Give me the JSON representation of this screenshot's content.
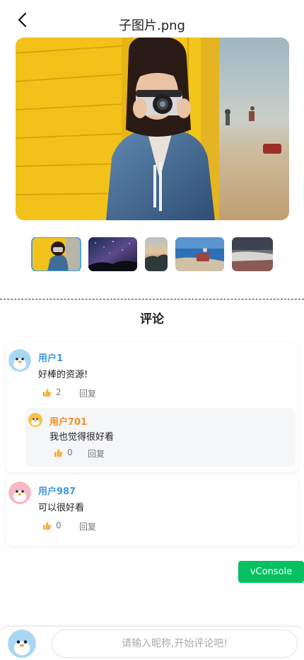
{
  "header": {
    "title": "子图片.png"
  },
  "section_title": "评论",
  "comments": [
    {
      "user": "用户1",
      "user_color": "#3f9ae6",
      "avatar_color": "#a9d7f3",
      "text": "好棒的资源!",
      "likes": "2",
      "reply_label": "回复",
      "replies": [
        {
          "user": "用户701",
          "user_color": "#f0902a",
          "avatar_color": "#f6c342",
          "text": "我也觉得很好看",
          "likes": "0",
          "reply_label": "回复"
        }
      ]
    },
    {
      "user": "用户987",
      "user_color": "#3f9ae6",
      "avatar_color": "#f6b8c4",
      "text": "可以很好看",
      "likes": "0",
      "reply_label": "回复"
    }
  ],
  "vconsole": {
    "label": "vConsole",
    "color": "#07c160"
  },
  "comment_input": {
    "placeholder": "请输入昵称,开始评论吧!"
  },
  "icons": [
    "back-arrow-icon",
    "thumbs-up-icon",
    "avatar-icon"
  ]
}
